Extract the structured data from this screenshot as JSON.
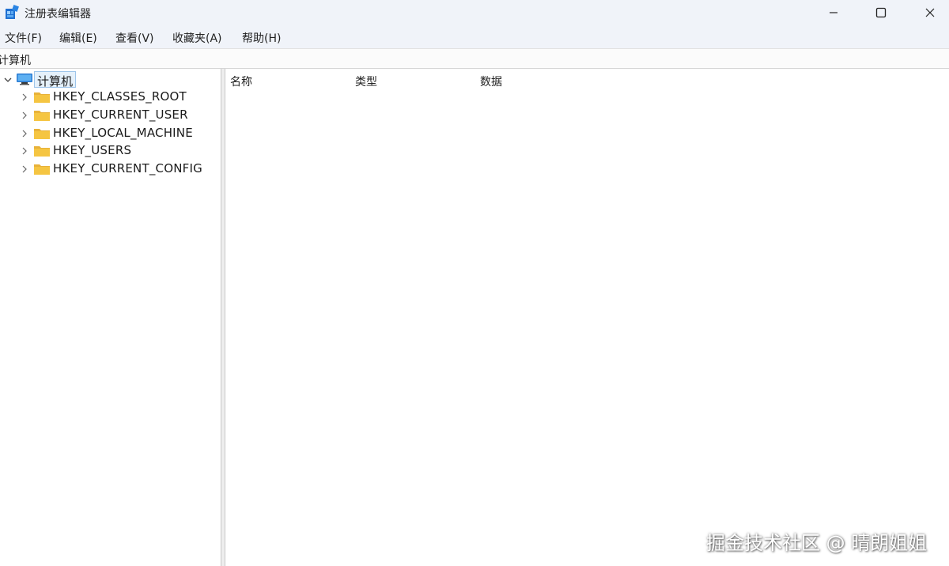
{
  "window": {
    "title": "注册表编辑器"
  },
  "menu": [
    {
      "label": "文件(F)"
    },
    {
      "label": "编辑(E)"
    },
    {
      "label": "查看(V)"
    },
    {
      "label": "收藏夹(A)"
    },
    {
      "label": "帮助(H)"
    }
  ],
  "address": {
    "path": "计算机"
  },
  "tree": {
    "root": {
      "label": "计算机",
      "icon": "computer-icon",
      "expanded": true,
      "selected": true
    },
    "keys": [
      {
        "label": "HKEY_CLASSES_ROOT",
        "icon": "folder-icon"
      },
      {
        "label": "HKEY_CURRENT_USER",
        "icon": "folder-icon"
      },
      {
        "label": "HKEY_LOCAL_MACHINE",
        "icon": "folder-icon"
      },
      {
        "label": "HKEY_USERS",
        "icon": "folder-icon"
      },
      {
        "label": "HKEY_CURRENT_CONFIG",
        "icon": "folder-icon"
      }
    ]
  },
  "list": {
    "columns": [
      {
        "label": "名称"
      },
      {
        "label": "类型"
      },
      {
        "label": "数据"
      }
    ]
  },
  "watermark": "掘金技术社区 @ 晴朗姐姐",
  "colors": {
    "folder": "#f5c542",
    "selection": "#e5f1fb",
    "titlebar": "#f0f3f9"
  }
}
